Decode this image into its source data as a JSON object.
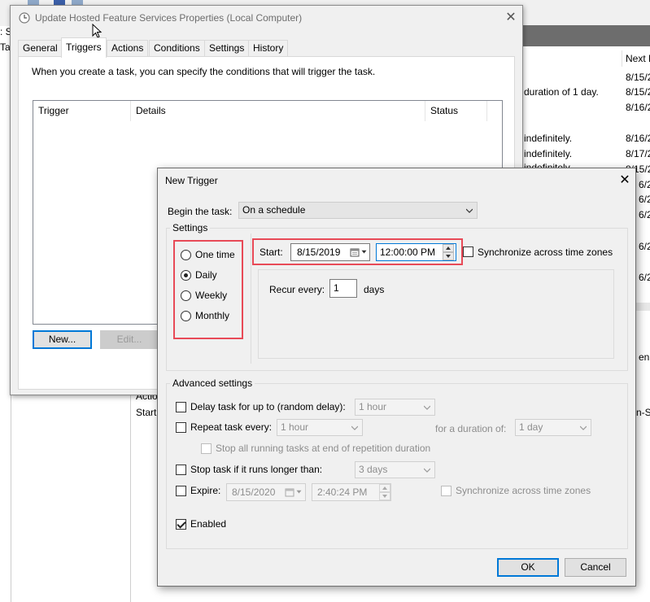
{
  "background_window": {
    "top_stub_text": ": S",
    "left_stub_text": "Tas",
    "column_header_next": "Next R",
    "rows": [
      {
        "text": "",
        "next": "8/15/2"
      },
      {
        "text": "duration of 1 day.",
        "next": "8/15/2"
      },
      {
        "text": "",
        "next": "8/16/2"
      },
      {
        "text": "indefinitely.",
        "next": "8/16/2"
      },
      {
        "text": "indefinitely.",
        "next": "8/17/2"
      },
      {
        "text": "indefinitely.",
        "next": "8/15/2"
      },
      {
        "text": "",
        "next": "6/2"
      },
      {
        "text": "",
        "next": "6/2"
      },
      {
        "text": "",
        "next": "6/2"
      },
      {
        "text": "",
        "next": "6/2"
      },
      {
        "text": "",
        "next": "6/2"
      }
    ],
    "right_snips": [
      "en",
      "n-S"
    ],
    "lower_labels": {
      "actions": "Actio",
      "start": "Start"
    }
  },
  "properties_window": {
    "title": "Update Hosted Feature Services Properties (Local Computer)",
    "tabs": [
      "General",
      "Triggers",
      "Actions",
      "Conditions",
      "Settings",
      "History"
    ],
    "active_tab": "Triggers",
    "description": "When you create a task, you can specify the conditions that will trigger the task.",
    "table_headers": [
      "Trigger",
      "Details",
      "Status"
    ],
    "buttons": {
      "new": "New...",
      "edit": "Edit..."
    }
  },
  "new_trigger_dialog": {
    "title": "New Trigger",
    "begin_label": "Begin the task:",
    "begin_value": "On a schedule",
    "settings_label": "Settings",
    "schedule_options": [
      "One time",
      "Daily",
      "Weekly",
      "Monthly"
    ],
    "selected_option": "Daily",
    "start_label": "Start:",
    "start_date": "8/15/2019",
    "start_time": "12:00:00 PM",
    "sync_label": "Synchronize across time zones",
    "recur_label": "Recur every:",
    "recur_value": "1",
    "recur_unit": "days",
    "advanced_label": "Advanced settings",
    "delay_label": "Delay task for up to (random delay):",
    "delay_value": "1 hour",
    "repeat_label": "Repeat task every:",
    "repeat_value": "1 hour",
    "duration_label": "for a duration of:",
    "duration_value": "1 day",
    "stop_running_label": "Stop all running tasks at end of repetition duration",
    "stop_longer_label": "Stop task if it runs longer than:",
    "stop_longer_value": "3 days",
    "expire_label": "Expire:",
    "expire_date": "8/15/2020",
    "expire_time": "2:40:24 PM",
    "expire_sync_label": "Synchronize across time zones",
    "enabled_label": "Enabled",
    "enabled": true,
    "ok_label": "OK",
    "cancel_label": "Cancel"
  },
  "colors": {
    "highlight_red": "#e84a57",
    "focus_blue": "#0078d7",
    "dialog_bg": "#f0f0f0"
  }
}
